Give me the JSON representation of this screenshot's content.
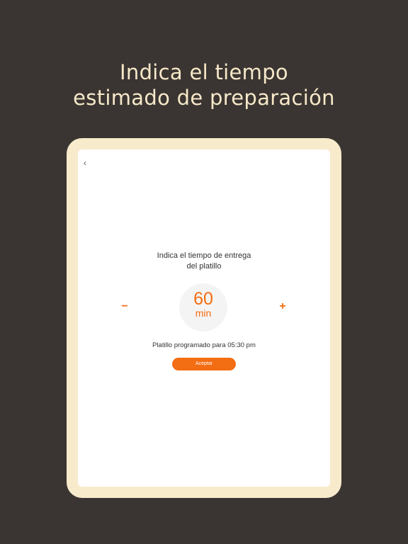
{
  "headline": {
    "line1": "Indica el tiempo",
    "line2": "estimado de preparación"
  },
  "screen": {
    "back_icon": "‹",
    "prompt_line1": "Indica el tiempo de entrega",
    "prompt_line2": "del platillo",
    "decrement_symbol": "−",
    "increment_symbol": "+",
    "time_value": "60",
    "time_unit": "min",
    "scheduled_text": "Platillo programado para 05:30 pm",
    "accept_label": "Aceptar"
  },
  "colors": {
    "background": "#3a3532",
    "headline": "#f6e8c8",
    "device_frame": "#f7ebcc",
    "accent": "#f36d12"
  }
}
